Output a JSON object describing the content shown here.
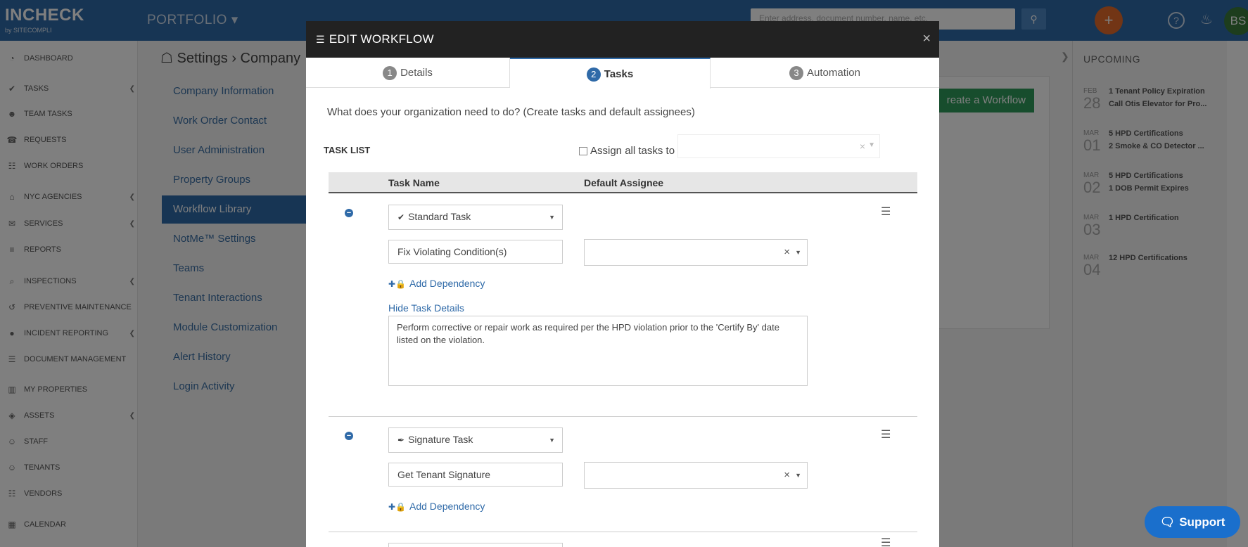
{
  "app": {
    "logo": "INCHECK",
    "logo_sub": "by SITECOMPLI",
    "portfolio_label": "PORTFOLIO ▾",
    "search_placeholder": "Enter address, document number, name, etc.",
    "avatar_initials": "BS"
  },
  "sidebar": {
    "items": [
      {
        "label": "DASHBOARD",
        "icon": "dashboard-icon",
        "glyph": "◔"
      },
      {
        "label": "TASKS",
        "icon": "check-circle-icon",
        "glyph": "✔"
      },
      {
        "label": "TEAM TASKS",
        "icon": "team-icon",
        "glyph": "☻"
      },
      {
        "label": "REQUESTS",
        "icon": "headset-icon",
        "glyph": "☎"
      },
      {
        "label": "WORK ORDERS",
        "icon": "clipboard-icon",
        "glyph": "☷"
      },
      {
        "label": "NYC AGENCIES",
        "icon": "building-icon",
        "glyph": "⌂"
      },
      {
        "label": "SERVICES",
        "icon": "envelope-icon",
        "glyph": "✉"
      },
      {
        "label": "REPORTS",
        "icon": "bar-chart-icon",
        "glyph": "≡"
      },
      {
        "label": "INSPECTIONS",
        "icon": "search-icon",
        "glyph": "⌕"
      },
      {
        "label": "PREVENTIVE MAINTENANCE",
        "icon": "history-icon",
        "glyph": "↺"
      },
      {
        "label": "INCIDENT REPORTING",
        "icon": "alert-icon",
        "glyph": "●"
      },
      {
        "label": "DOCUMENT MANAGEMENT",
        "icon": "document-icon",
        "glyph": "☰"
      },
      {
        "label": "MY PROPERTIES",
        "icon": "building-icon",
        "glyph": "▥"
      },
      {
        "label": "ASSETS",
        "icon": "cube-icon",
        "glyph": "◈"
      },
      {
        "label": "STAFF",
        "icon": "user-icon",
        "glyph": "☺"
      },
      {
        "label": "TENANTS",
        "icon": "user-icon",
        "glyph": "☺"
      },
      {
        "label": "VENDORS",
        "icon": "sitemap-icon",
        "glyph": "☷"
      },
      {
        "label": "CALENDAR",
        "icon": "calendar-icon",
        "glyph": "▦"
      }
    ]
  },
  "settings": {
    "title": "Settings › Company",
    "menu": [
      "Company Information",
      "Work Order Contact",
      "User Administration",
      "Property Groups",
      "Workflow Library",
      "NotMe™ Settings",
      "Teams",
      "Tenant Interactions",
      "Module Customization",
      "Alert History",
      "Login Activity"
    ],
    "create_button": "reate a Workflow"
  },
  "upcoming": {
    "title": "UPCOMING",
    "items": [
      {
        "month": "FEB",
        "day": "28",
        "line1": "1 Tenant Policy Expiration",
        "line2": "Call Otis Elevator for Pro..."
      },
      {
        "month": "MAR",
        "day": "01",
        "line1": "5 HPD Certifications",
        "line2": "2 Smoke & CO Detector ..."
      },
      {
        "month": "MAR",
        "day": "02",
        "line1": "5 HPD Certifications",
        "line2": "1 DOB Permit Expires"
      },
      {
        "month": "MAR",
        "day": "03",
        "line1": "1 HPD Certification",
        "line2": ""
      },
      {
        "month": "MAR",
        "day": "04",
        "line1": "12 HPD Certifications",
        "line2": ""
      }
    ]
  },
  "modal": {
    "title": "EDIT WORKFLOW",
    "tabs": [
      {
        "num": "1",
        "label": "Details"
      },
      {
        "num": "2",
        "label": "Tasks"
      },
      {
        "num": "3",
        "label": "Automation"
      }
    ],
    "question": "What does your organization need to do? (Create tasks and default assignees)",
    "task_list_label": "TASK LIST",
    "assign_all_label": "Assign all tasks to",
    "col_task_name": "Task Name",
    "col_default_assignee": "Default Assignee",
    "tasks": [
      {
        "type": "Standard Task",
        "name": "Fix Violating Condition(s)",
        "add_dependency": "Add Dependency",
        "hide_details": "Hide Task Details",
        "description": "Perform corrective or repair work as required per the HPD violation prior to the 'Certify By' date listed on the violation."
      },
      {
        "type": "Signature Task",
        "name": "Get Tenant Signature",
        "add_dependency": "Add Dependency"
      }
    ]
  },
  "support": {
    "label": "Support"
  },
  "colors": {
    "brand_blue": "#2f6aa8",
    "create_green": "#2e9b5a",
    "add_orange": "#e46b2a",
    "support_blue": "#1a6fcc"
  }
}
